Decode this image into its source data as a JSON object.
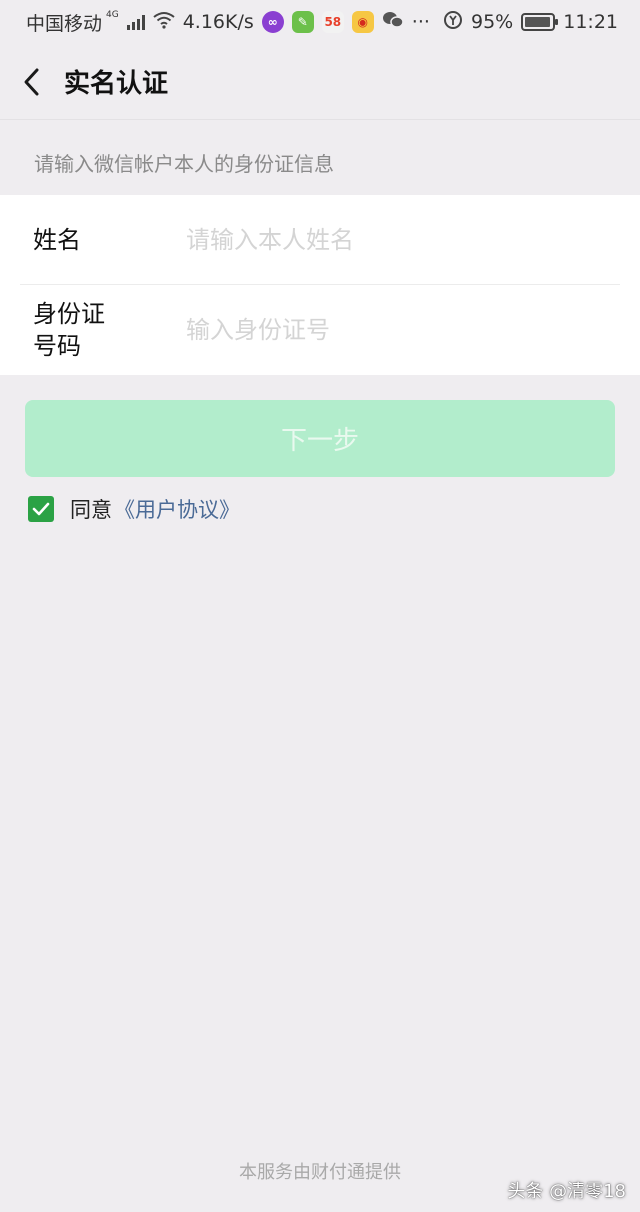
{
  "status_bar": {
    "carrier": "中国移动",
    "network_tag": "4G",
    "speed": "4.16K/s",
    "apps": [
      "loop-icon",
      "green-app-icon",
      "58-icon",
      "weibo-icon",
      "wechat-icon"
    ],
    "app_58_text": "58",
    "more": "···",
    "battery_percent": "95%",
    "time": "11:21"
  },
  "nav": {
    "title": "实名认证"
  },
  "hint": "请输入微信帐户本人的身份证信息",
  "form": {
    "name_label": "姓名",
    "name_placeholder": "请输入本人姓名",
    "id_label_line1": "身份证",
    "id_label_line2": "号码",
    "id_placeholder": "输入身份证号"
  },
  "next_button": "下一步",
  "agree": {
    "text": "同意",
    "link": "《用户协议》",
    "checked": true
  },
  "footer": "本服务由财付通提供",
  "watermark": "头条 @清零18",
  "colors": {
    "background": "#efedf0",
    "button_disabled": "#b2edcc",
    "checkbox": "#2ba245",
    "link": "#4a6a96"
  }
}
